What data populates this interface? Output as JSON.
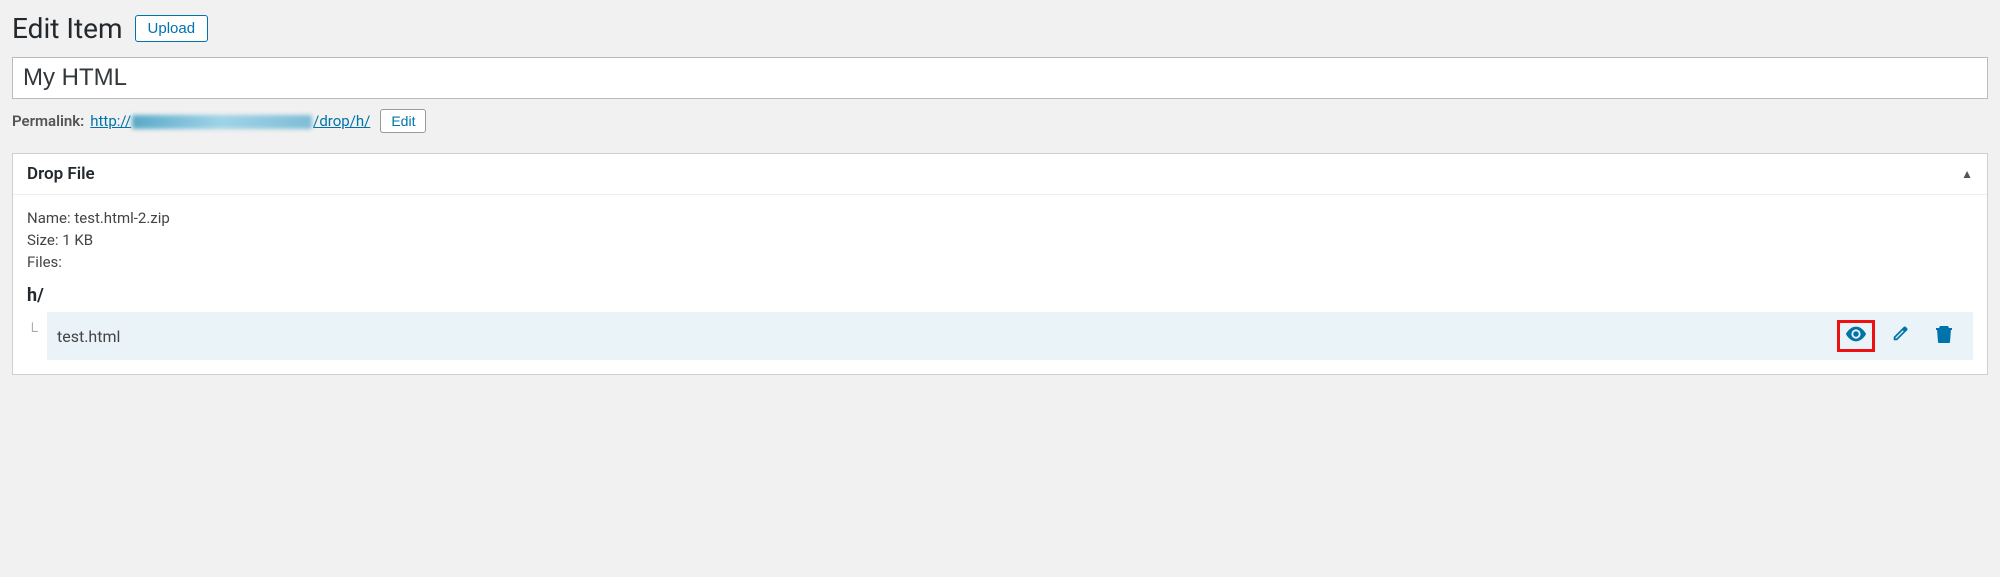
{
  "header": {
    "title": "Edit Item",
    "upload_label": "Upload"
  },
  "title_field": {
    "value": "My HTML"
  },
  "permalink": {
    "label": "Permalink:",
    "prefix": "http://",
    "suffix": "/drop/h/",
    "edit_label": "Edit"
  },
  "dropfile_box": {
    "title": "Drop File",
    "name_label": "Name:",
    "name_value": "test.html-2.zip",
    "size_label": "Size:",
    "size_value": "1 KB",
    "files_label": "Files:",
    "folder": "h/",
    "file": "test.html"
  }
}
